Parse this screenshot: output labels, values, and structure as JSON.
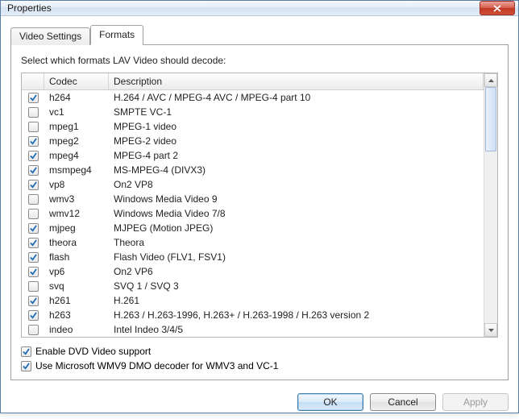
{
  "window": {
    "title": "Properties"
  },
  "tabs": [
    {
      "label": "Video Settings",
      "active": false
    },
    {
      "label": "Formats",
      "active": true
    }
  ],
  "panel": {
    "instruction": "Select which formats LAV Video should decode:",
    "headers": {
      "codec": "Codec",
      "description": "Description"
    },
    "rows": [
      {
        "checked": true,
        "codec": "h264",
        "desc": "H.264 / AVC / MPEG-4 AVC / MPEG-4 part 10"
      },
      {
        "checked": false,
        "codec": "vc1",
        "desc": "SMPTE VC-1"
      },
      {
        "checked": false,
        "codec": "mpeg1",
        "desc": "MPEG-1 video"
      },
      {
        "checked": true,
        "codec": "mpeg2",
        "desc": "MPEG-2 video"
      },
      {
        "checked": true,
        "codec": "mpeg4",
        "desc": "MPEG-4 part 2"
      },
      {
        "checked": true,
        "codec": "msmpeg4",
        "desc": "MS-MPEG-4 (DIVX3)"
      },
      {
        "checked": true,
        "codec": "vp8",
        "desc": "On2 VP8"
      },
      {
        "checked": false,
        "codec": "wmv3",
        "desc": "Windows Media Video 9"
      },
      {
        "checked": false,
        "codec": "wmv12",
        "desc": "Windows Media Video 7/8"
      },
      {
        "checked": true,
        "codec": "mjpeg",
        "desc": "MJPEG (Motion JPEG)"
      },
      {
        "checked": true,
        "codec": "theora",
        "desc": "Theora"
      },
      {
        "checked": true,
        "codec": "flash",
        "desc": "Flash Video (FLV1, FSV1)"
      },
      {
        "checked": true,
        "codec": "vp6",
        "desc": "On2 VP6"
      },
      {
        "checked": false,
        "codec": "svq",
        "desc": "SVQ 1 / SVQ 3"
      },
      {
        "checked": true,
        "codec": "h261",
        "desc": "H.261"
      },
      {
        "checked": true,
        "codec": "h263",
        "desc": "H.263 / H.263-1996, H.263+ / H.263-1998 / H.263 version 2"
      },
      {
        "checked": false,
        "codec": "indeo",
        "desc": "Intel Indeo 3/4/5"
      }
    ],
    "options": {
      "dvd": {
        "checked": true,
        "label": "Enable DVD Video support"
      },
      "wmv9": {
        "checked": true,
        "label": "Use Microsoft WMV9 DMO decoder for WMV3 and VC-1"
      }
    }
  },
  "buttons": {
    "ok": "OK",
    "cancel": "Cancel",
    "apply": "Apply"
  }
}
